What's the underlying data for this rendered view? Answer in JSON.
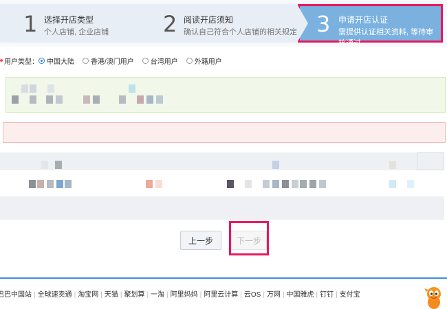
{
  "steps": [
    {
      "num": "1",
      "title": "选择开店类型",
      "desc": "个人店铺, 企业店铺"
    },
    {
      "num": "2",
      "title": "阅读开店须知",
      "desc": "确认自己符合个人店铺的相关规定"
    },
    {
      "num": "3",
      "title": "申请开店认证",
      "desc": "需提供认证相关资料, 等待审核通过"
    }
  ],
  "user_type": {
    "label": "用户类型：",
    "options": [
      "中国大陆",
      "香港/澳门用户",
      "台湾用户",
      "外籍用户"
    ],
    "selected": "中国大陆"
  },
  "buttons": {
    "prev": "上一步",
    "next": "下一步"
  },
  "footer": {
    "links": [
      "阿里巴巴中国站",
      "全球速卖通",
      "淘宝网",
      "天猫",
      "聚划算",
      "一淘",
      "阿里妈妈",
      "阿里云计算",
      "云OS",
      "万网",
      "中国雅虎",
      "钉钉",
      "支付宝"
    ]
  },
  "colors": {
    "accent": "#7ab1df",
    "highlight": "#e8175d",
    "footer_line": "#3d8ce0"
  }
}
